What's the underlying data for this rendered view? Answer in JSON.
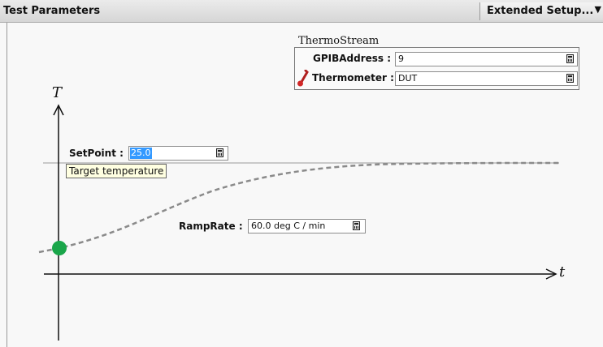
{
  "header": {
    "title": "Test Parameters",
    "extended_setup_label": "Extended Setup...",
    "dropdown_icon": "caret-down-icon"
  },
  "thermostream": {
    "caption": "ThermoStream",
    "gpib_label": "GPIBAddress :",
    "gpib_value": "9",
    "thermometer_label": "Thermometer :",
    "thermometer_value": "DUT",
    "thermometer_icon": "thermometer-icon"
  },
  "diagram": {
    "y_axis_label": "T",
    "x_axis_label": "t",
    "setpoint_label": "SetPoint :",
    "setpoint_value": "25.0",
    "setpoint_tooltip": "Target temperature",
    "ramprate_label": "RampRate :",
    "ramprate_value": "60.0 deg C / min",
    "start_marker_color": "#1aa64a",
    "curve_color": "#8a8a8a"
  }
}
